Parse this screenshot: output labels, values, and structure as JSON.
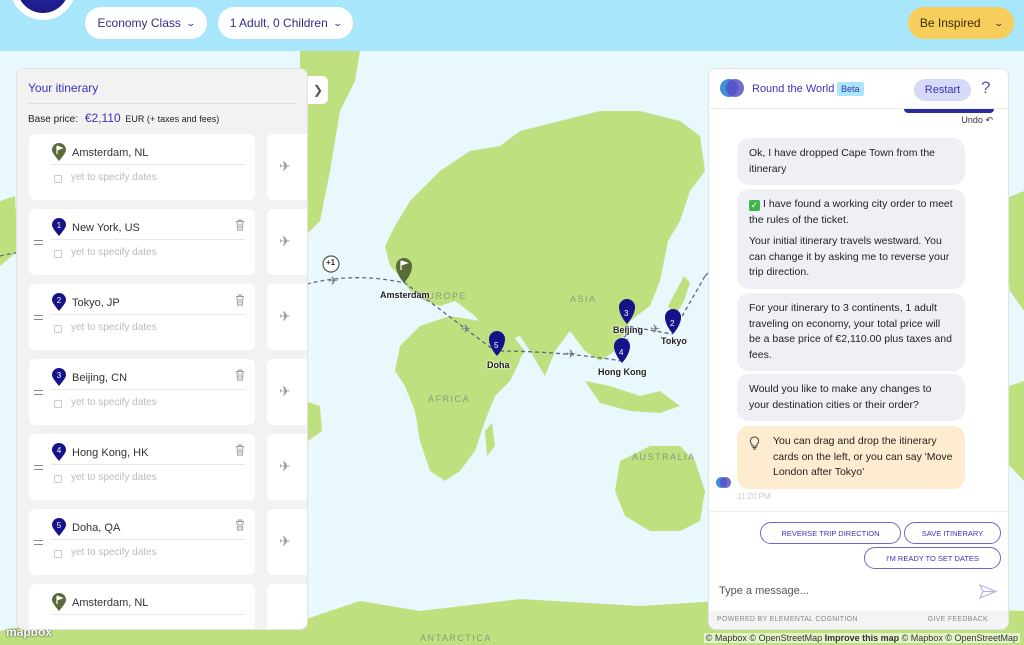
{
  "header": {
    "cabin_class": "Economy Class",
    "travellers": "1 Adult, 0 Children",
    "inspire": "Be Inspired"
  },
  "itinerary": {
    "title": "Your itinerary",
    "base_price_label": "Base price:",
    "base_price_amount": "€2,110",
    "base_price_suffix": "EUR (+ taxes and fees)",
    "date_placeholder": "yet to specify dates",
    "stops": [
      {
        "city": "Amsterdam, NL",
        "marker": "",
        "type": "origin",
        "removable": false
      },
      {
        "city": "New York, US",
        "marker": "1",
        "type": "stop",
        "removable": true
      },
      {
        "city": "Tokyo, JP",
        "marker": "2",
        "type": "stop",
        "removable": true
      },
      {
        "city": "Beijing, CN",
        "marker": "3",
        "type": "stop",
        "removable": true
      },
      {
        "city": "Hong Kong, HK",
        "marker": "4",
        "type": "stop",
        "removable": true
      },
      {
        "city": "Doha, QA",
        "marker": "5",
        "type": "stop",
        "removable": true
      },
      {
        "city": "Amsterdam, NL",
        "marker": "",
        "type": "destination",
        "removable": false
      }
    ]
  },
  "map": {
    "continents": [
      "EUROPE",
      "ASIA",
      "AFRICA",
      "AUSTRALIA",
      "ANTARCTICA"
    ],
    "day_badge": "+1",
    "cities": [
      {
        "name": "Amsterdam",
        "marker": ""
      },
      {
        "name": "Tokyo",
        "marker": "2"
      },
      {
        "name": "Beijing",
        "marker": "3"
      },
      {
        "name": "Hong Kong",
        "marker": "4"
      },
      {
        "name": "Doha",
        "marker": "5"
      }
    ],
    "logo": "mapbox",
    "attribution_prefix": "© Mapbox © OpenStreetMap",
    "attribution_link": "Improve this map",
    "attribution_suffix": "© Mapbox © OpenStreetMap"
  },
  "chat": {
    "title": "Round the World",
    "badge": "Beta",
    "restart": "Restart",
    "help": "?",
    "undo": "Undo",
    "messages": [
      {
        "text": "Ok, I have dropped Cape Town from the itinerary"
      },
      {
        "text": "I have found a working city order to meet the rules of the ticket.",
        "text2": "Your initial itinerary travels westward. You can change it by asking me to reverse your trip direction."
      },
      {
        "text": "For your itinerary to 3 continents, 1 adult traveling on economy, your total price will be a base price of €2,110.00 plus taxes and fees."
      },
      {
        "text": "Would you like to make any changes to your destination cities or their order?"
      },
      {
        "text": "You can drag and drop the itinerary cards on the left, or you can say 'Move London after Tokyo'"
      }
    ],
    "timestamp": "11:20 PM",
    "suggestions": [
      "REVERSE TRIP DIRECTION",
      "SAVE ITINERARY",
      "I'M READY TO SET DATES"
    ],
    "input_placeholder": "Type a message...",
    "powered_by": "POWERED BY ELEMENTAL COGNITION",
    "feedback": "GIVE FEEDBACK"
  },
  "colors": {
    "header_bg": "#a8e6fb",
    "accent": "#3a36b8",
    "marker_blue": "#16128a",
    "marker_green": "#5a6b3a",
    "inspire_yellow": "#f7cd5b",
    "land": "#bfe07e",
    "water": "#e9f8fd"
  }
}
